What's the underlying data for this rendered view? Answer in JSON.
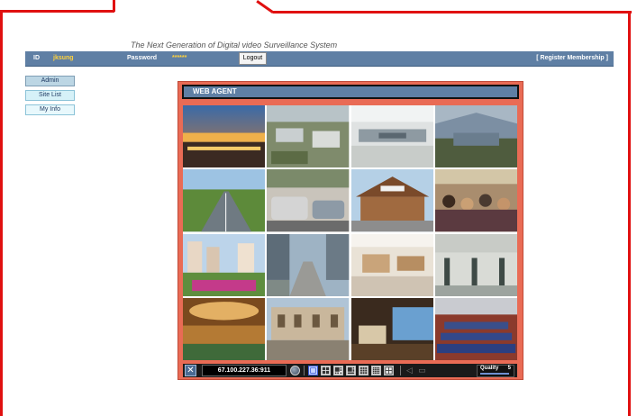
{
  "header": {
    "tagline": "The Next Generation of Digital video Surveillance System"
  },
  "topbar": {
    "id_label": "ID",
    "id_value": "jksung",
    "password_label": "Password",
    "password_value": "******",
    "logout_label": "Logout",
    "register_label": "[ Register Membership ]"
  },
  "sidebar": {
    "items": [
      {
        "label": "Admin"
      },
      {
        "label": "Site List"
      },
      {
        "label": "My Info"
      }
    ]
  },
  "web_agent": {
    "title": "WEB AGENT",
    "camera_count": 16,
    "address": "67.100.227.36:911",
    "quality_label": "Quality",
    "quality_value": "5",
    "layout_options": [
      "1x1",
      "2x2",
      "1+5",
      "1+7",
      "3x3",
      "4x4",
      "custom"
    ],
    "active_layout": "1x1"
  },
  "colors": {
    "frame_red": "#e01010",
    "bar_blue": "#5f7fa4",
    "agent_border": "#e96b55",
    "user_yellow": "#ffd23c"
  }
}
